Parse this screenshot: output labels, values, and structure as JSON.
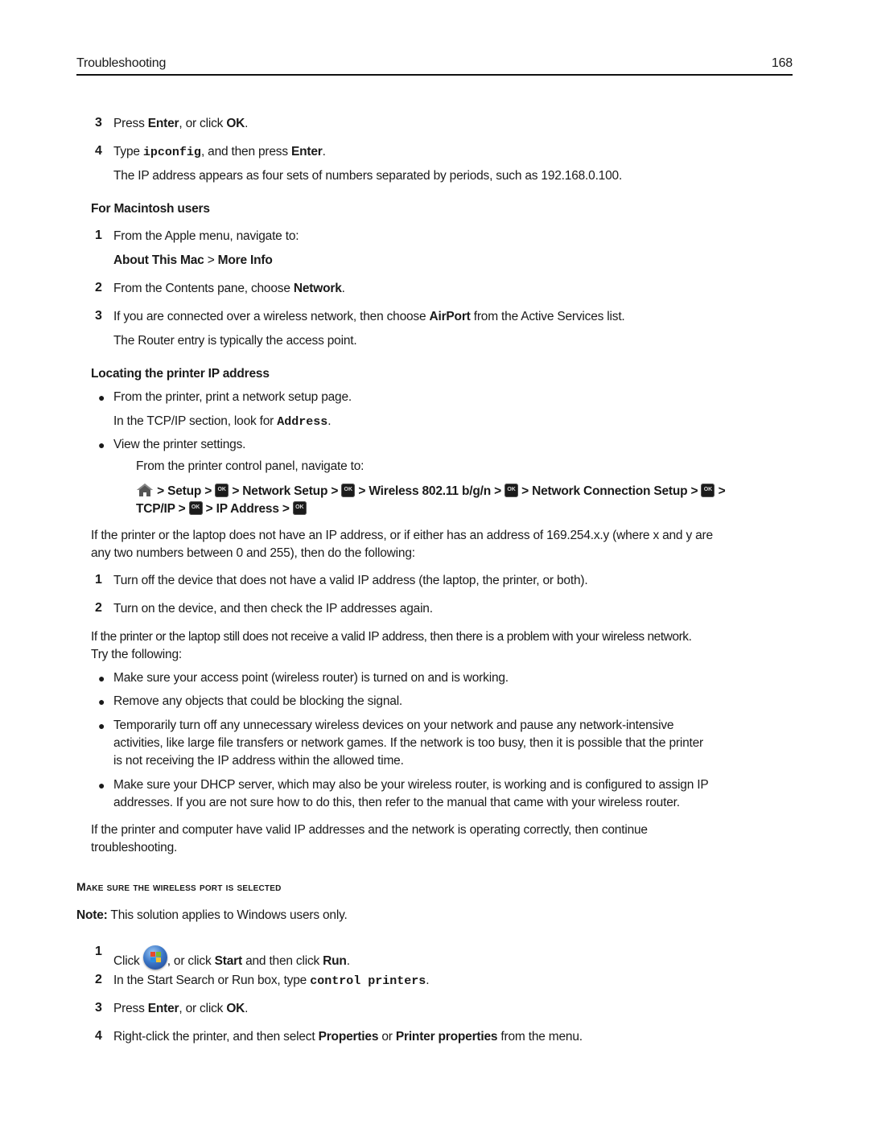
{
  "header": {
    "title": "Troubleshooting",
    "page_number": "168"
  },
  "windows_steps_cont": [
    {
      "num": "3",
      "pre": "Press ",
      "b1": "Enter",
      "mid": ", or click ",
      "b2": "OK",
      "post": "."
    },
    {
      "num": "4",
      "pre": "Type ",
      "code": "ipconfig",
      "mid": ", and then press ",
      "b1": "Enter",
      "post": "."
    }
  ],
  "ip_note": "The IP address appears as four sets of numbers separated by periods, such as 192.168.0.100.",
  "mac": {
    "heading": "For Macintosh users",
    "step1": {
      "num": "1",
      "text": "From the Apple menu, navigate to:",
      "path_a": "About This Mac",
      "sep": " > ",
      "path_b": "More Info"
    },
    "step2": {
      "num": "2",
      "pre": "From the Contents pane, choose ",
      "bold": "Network",
      "post": "."
    },
    "step3": {
      "num": "3",
      "pre": "If you are connected over a wireless network, then choose ",
      "bold": "AirPort",
      "post": " from the Active Services list.",
      "note": "The Router entry is typically the access point."
    }
  },
  "locating": {
    "heading": "Locating the printer IP address",
    "bullet1": {
      "text": "From the printer, print a network setup page.",
      "sub_pre": "In the TCP/IP section, look for ",
      "sub_code": "Address",
      "sub_post": "."
    },
    "bullet2": {
      "text": "View the printer settings.",
      "sub": "From the printer control panel, navigate to:"
    },
    "nav_path": {
      "sep": " > ",
      "ok_label": "OK",
      "items": [
        "Setup",
        "Network Setup",
        "Wireless 802.11 b/g/n",
        "Network Connection Setup",
        "TCP/IP",
        "IP Address"
      ]
    }
  },
  "no_ip": {
    "para": "If the printer or the laptop does not have an IP address, or if either has an address of 169.254.x.y (where x and y are",
    "para2": "any two numbers between 0 and 255), then do the following:",
    "steps": [
      {
        "num": "1",
        "text": "Turn off the device that does not have a valid IP address (the laptop, the printer, or both)."
      },
      {
        "num": "2",
        "text": "Turn on the device, and then check the IP addresses again."
      }
    ]
  },
  "still_no_ip": {
    "para": "If the printer or the laptop still does not receive a valid IP address, then there is a problem with your wireless network.",
    "para2": "Try the following:",
    "bullets": [
      [
        "Make sure your access point (wireless router) is turned on and is working."
      ],
      [
        "Remove any objects that could be blocking the signal."
      ],
      [
        "Temporarily turn off any unnecessary wireless devices on your network and pause any network-intensive",
        "activities, like large file transfers or network games. If the network is too busy, then it is possible that the printer",
        "is not receiving the IP address within the allowed time."
      ],
      [
        "Make sure your DHCP server, which may also be your wireless router, is working and is configured to assign IP",
        "addresses. If you are not sure how to do this, then refer to the manual that came with your wireless router."
      ]
    ],
    "closing": "If the printer and computer have valid IP addresses and the network is operating correctly, then continue",
    "closing2": "troubleshooting."
  },
  "wireless_port": {
    "heading": "Make sure the wireless port is selected",
    "note_label": "Note:",
    "note_text": " This solution applies to Windows users only.",
    "step1": {
      "num": "1",
      "pre": "Click ",
      "mid": ", or click ",
      "b1": "Start",
      "mid2": " and then click ",
      "b2": "Run",
      "post": "."
    },
    "step2": {
      "num": "2",
      "pre": "In the Start Search or Run box, type ",
      "code": "control printers",
      "post": "."
    },
    "step3": {
      "num": "3",
      "pre": "Press ",
      "b1": "Enter",
      "mid": ", or click ",
      "b2": "OK",
      "post": "."
    },
    "step4": {
      "num": "4",
      "pre": "Right-click the printer, and then select ",
      "b1": "Properties",
      "mid": " or ",
      "b2": "Printer properties",
      "post": " from the menu."
    }
  }
}
